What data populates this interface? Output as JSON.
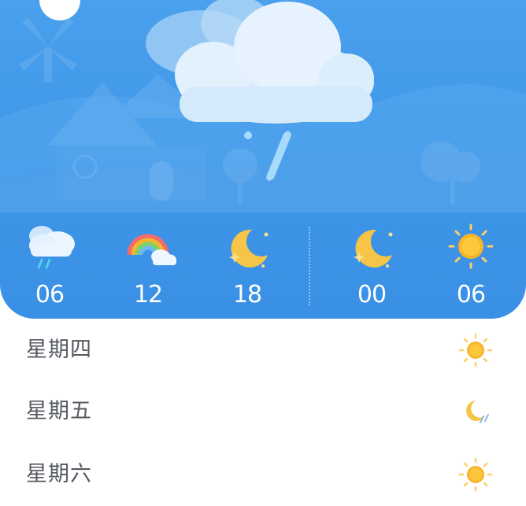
{
  "hourly": [
    {
      "time": "06",
      "icon": "cloud-rain-icon"
    },
    {
      "time": "12",
      "icon": "rainbow-icon"
    },
    {
      "time": "18",
      "icon": "moon-icon"
    },
    {
      "time": "00",
      "icon": "moon-icon"
    },
    {
      "time": "06",
      "icon": "sun-icon"
    }
  ],
  "daily": [
    {
      "day": "星期四",
      "icon": "sun-icon"
    },
    {
      "day": "星期五",
      "icon": "moon-rain-icon"
    },
    {
      "day": "星期六",
      "icon": "sun-icon"
    }
  ],
  "colors": {
    "sky": "#3d95e8",
    "sun": "#f8b52a",
    "moon": "#f6c548",
    "text_dark": "#555a60"
  }
}
